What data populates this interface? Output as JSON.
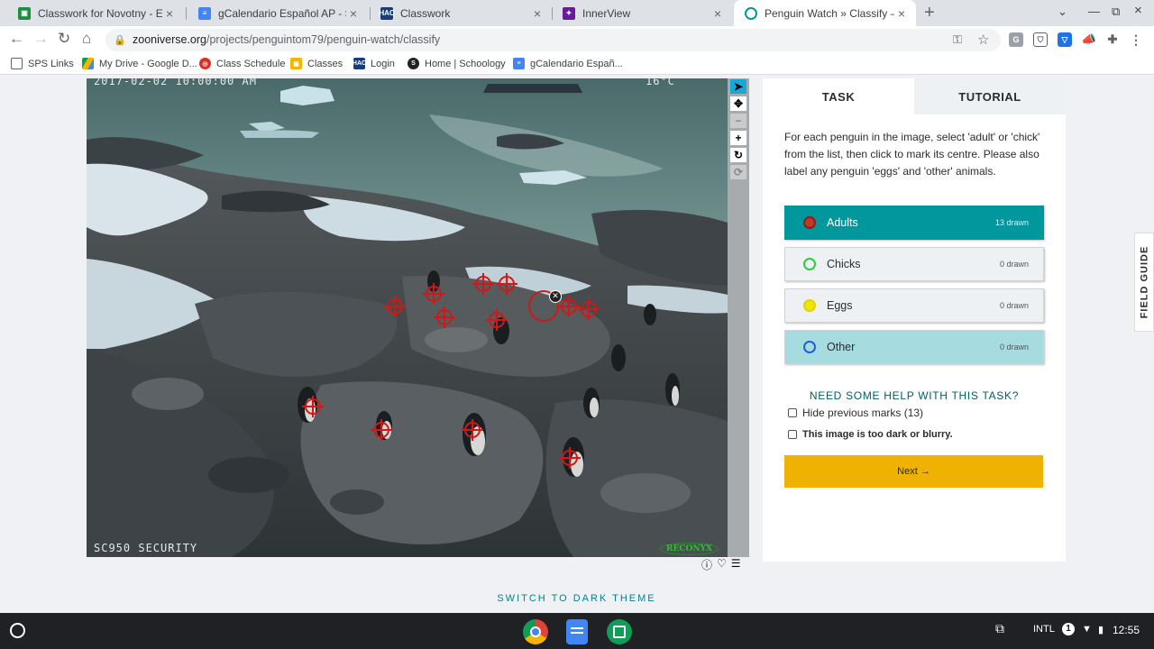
{
  "browser": {
    "tabs": [
      {
        "title": "Classwork for Novotny - Españo",
        "active": false
      },
      {
        "title": "gCalendario Español AP - SHS -",
        "active": false
      },
      {
        "title": "Classwork",
        "active": false
      },
      {
        "title": "InnerView",
        "active": false
      },
      {
        "title": "Penguin Watch » Classify — Zoo",
        "active": true
      }
    ],
    "url_domain": "zooniverse.org",
    "url_path": "/projects/penguintom79/penguin-watch/classify"
  },
  "bookmarks": [
    "SPS Links",
    "My Drive - Google D...",
    "Class Schedule",
    "Classes",
    "Login",
    "Home | Schoology",
    "gCalendario Españ..."
  ],
  "subject": {
    "timestamp": "2017-02-02 10:00:00 AM",
    "temperature": "16°C",
    "camera": "SC950 SECURITY",
    "brand": "RECONYX"
  },
  "task": {
    "tab_task": "TASK",
    "tab_tutorial": "TUTORIAL",
    "instructions": "For each penguin in the image, select 'adult' or 'chick' from the list, then click to mark its centre. Please also label any penguin 'eggs' and 'other' animals.",
    "choices": [
      {
        "label": "Adults",
        "count": "13 drawn",
        "color": "#c0392b"
      },
      {
        "label": "Chicks",
        "count": "0 drawn",
        "color": "#2ecc40"
      },
      {
        "label": "Eggs",
        "count": "0 drawn",
        "color": "#f2e600"
      },
      {
        "label": "Other",
        "count": "0 drawn",
        "color": "#1f5fd6"
      }
    ],
    "help_link": "NEED SOME HELP WITH THIS TASK?",
    "hide_marks": "Hide previous marks (13)",
    "too_dark": "This image is too dark or blurry.",
    "next_label": "Next →"
  },
  "field_guide": "FIELD GUIDE",
  "theme_link": "SWITCH TO DARK THEME",
  "shelf": {
    "locale": "INTL",
    "notifications": "1",
    "time": "12:55"
  }
}
